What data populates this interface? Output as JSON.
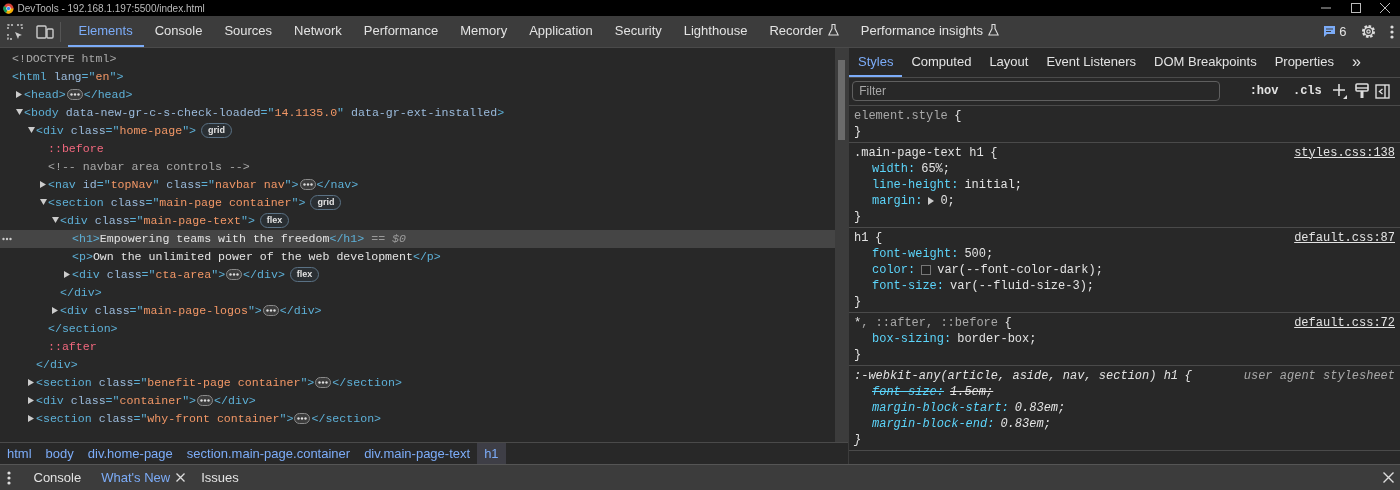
{
  "window": {
    "title": "DevTools - 192.168.1.197:5500/index.html"
  },
  "main_tabs": [
    {
      "label": "Elements",
      "selected": true,
      "experimental": false
    },
    {
      "label": "Console",
      "selected": false,
      "experimental": false
    },
    {
      "label": "Sources",
      "selected": false,
      "experimental": false
    },
    {
      "label": "Network",
      "selected": false,
      "experimental": false
    },
    {
      "label": "Performance",
      "selected": false,
      "experimental": false
    },
    {
      "label": "Memory",
      "selected": false,
      "experimental": false
    },
    {
      "label": "Application",
      "selected": false,
      "experimental": false
    },
    {
      "label": "Security",
      "selected": false,
      "experimental": false
    },
    {
      "label": "Lighthouse",
      "selected": false,
      "experimental": false
    },
    {
      "label": "Recorder",
      "selected": false,
      "experimental": true
    },
    {
      "label": "Performance insights",
      "selected": false,
      "experimental": true
    }
  ],
  "issues_count": "6",
  "dom_tree": [
    {
      "tokens": [
        {
          "kind": "doctype",
          "text": "<!DOCTYPE html>"
        }
      ]
    },
    {
      "tokens": [
        {
          "kind": "tag",
          "text": "<html "
        },
        {
          "kind": "attr",
          "text": "lang"
        },
        {
          "kind": "tag",
          "text": "=\""
        },
        {
          "kind": "value",
          "text": "en"
        },
        {
          "kind": "tag",
          "text": "\">"
        }
      ],
      "children": [
        {
          "tokens": [
            {
              "kind": "tag",
              "text": "<head>"
            }
          ],
          "expanded": false,
          "ellipsis": true,
          "close_tokens": [
            {
              "kind": "tag",
              "text": "</head>"
            }
          ]
        },
        {
          "tokens": [
            {
              "kind": "tag",
              "text": "<body "
            },
            {
              "kind": "attr",
              "text": "data-new-gr-c-s-check-loaded"
            },
            {
              "kind": "tag",
              "text": "=\""
            },
            {
              "kind": "value",
              "text": "14.1135.0"
            },
            {
              "kind": "tag",
              "text": "\" "
            },
            {
              "kind": "attr",
              "text": "data-gr-ext-installed"
            },
            {
              "kind": "tag",
              "text": ">"
            }
          ],
          "expanded": true,
          "children": [
            {
              "tokens": [
                {
                  "kind": "tag",
                  "text": "<div "
                },
                {
                  "kind": "attr",
                  "text": "class"
                },
                {
                  "kind": "tag",
                  "text": "=\""
                },
                {
                  "kind": "value",
                  "text": "home-page"
                },
                {
                  "kind": "tag",
                  "text": "\">"
                }
              ],
              "expanded": true,
              "badge": "grid",
              "children": [
                {
                  "tokens": [
                    {
                      "kind": "pseudo",
                      "text": "::before"
                    }
                  ]
                },
                {
                  "tokens": [
                    {
                      "kind": "comment",
                      "text": "<!-- navbar area controls  -->"
                    }
                  ]
                },
                {
                  "tokens": [
                    {
                      "kind": "tag",
                      "text": "<nav "
                    },
                    {
                      "kind": "attr",
                      "text": "id"
                    },
                    {
                      "kind": "tag",
                      "text": "=\""
                    },
                    {
                      "kind": "value",
                      "text": "topNav"
                    },
                    {
                      "kind": "tag",
                      "text": "\" "
                    },
                    {
                      "kind": "attr",
                      "text": "class"
                    },
                    {
                      "kind": "tag",
                      "text": "=\""
                    },
                    {
                      "kind": "value",
                      "text": "navbar nav"
                    },
                    {
                      "kind": "tag",
                      "text": "\">"
                    }
                  ],
                  "expanded": false,
                  "ellipsis": true,
                  "close_tokens": [
                    {
                      "kind": "tag",
                      "text": "</nav>"
                    }
                  ]
                },
                {
                  "tokens": [
                    {
                      "kind": "tag",
                      "text": "<section "
                    },
                    {
                      "kind": "attr",
                      "text": "class"
                    },
                    {
                      "kind": "tag",
                      "text": "=\""
                    },
                    {
                      "kind": "value",
                      "text": "main-page container"
                    },
                    {
                      "kind": "tag",
                      "text": "\">"
                    }
                  ],
                  "expanded": true,
                  "badge": "grid",
                  "children": [
                    {
                      "tokens": [
                        {
                          "kind": "tag",
                          "text": "<div "
                        },
                        {
                          "kind": "attr",
                          "text": "class"
                        },
                        {
                          "kind": "tag",
                          "text": "=\""
                        },
                        {
                          "kind": "value",
                          "text": "main-page-text"
                        },
                        {
                          "kind": "tag",
                          "text": "\">"
                        }
                      ],
                      "expanded": true,
                      "badge": "flex",
                      "children": [
                        {
                          "tokens": [
                            {
                              "kind": "tag",
                              "text": "<h1>"
                            },
                            {
                              "kind": "text",
                              "text": "Empowering teams with the freedom"
                            },
                            {
                              "kind": "tag",
                              "text": "</h1>"
                            },
                            {
                              "kind": "marker",
                              "text": " == $0"
                            }
                          ],
                          "selected": true
                        },
                        {
                          "tokens": [
                            {
                              "kind": "tag",
                              "text": "<p>"
                            },
                            {
                              "kind": "text",
                              "text": "Own the unlimited power of the web development"
                            },
                            {
                              "kind": "tag",
                              "text": "</p>"
                            }
                          ],
                          "selected": false
                        },
                        {
                          "tokens": [
                            {
                              "kind": "tag",
                              "text": "<div "
                            },
                            {
                              "kind": "attr",
                              "text": "class"
                            },
                            {
                              "kind": "tag",
                              "text": "=\""
                            },
                            {
                              "kind": "value",
                              "text": "cta-area"
                            },
                            {
                              "kind": "tag",
                              "text": "\">"
                            }
                          ],
                          "expanded": false,
                          "ellipsis": true,
                          "close_tokens": [
                            {
                              "kind": "tag",
                              "text": "</div>"
                            }
                          ],
                          "badge": "flex",
                          "selected": false
                        }
                      ],
                      "closing": [
                        {
                          "kind": "tag",
                          "text": "</div>"
                        }
                      ]
                    },
                    {
                      "tokens": [
                        {
                          "kind": "tag",
                          "text": "<div "
                        },
                        {
                          "kind": "attr",
                          "text": "class"
                        },
                        {
                          "kind": "tag",
                          "text": "=\""
                        },
                        {
                          "kind": "value",
                          "text": "main-page-logos"
                        },
                        {
                          "kind": "tag",
                          "text": "\">"
                        }
                      ],
                      "expanded": false,
                      "ellipsis": true,
                      "close_tokens": [
                        {
                          "kind": "tag",
                          "text": "</div>"
                        }
                      ]
                    }
                  ],
                  "closing": [
                    {
                      "kind": "tag",
                      "text": "</section>"
                    }
                  ]
                },
                {
                  "tokens": [
                    {
                      "kind": "pseudo",
                      "text": "::after"
                    }
                  ]
                }
              ],
              "closing": [
                {
                  "kind": "tag",
                  "text": "</div>"
                }
              ]
            },
            {
              "tokens": [
                {
                  "kind": "tag",
                  "text": "<section "
                },
                {
                  "kind": "attr",
                  "text": "class"
                },
                {
                  "kind": "tag",
                  "text": "=\""
                },
                {
                  "kind": "value",
                  "text": "benefit-page container"
                },
                {
                  "kind": "tag",
                  "text": "\">"
                }
              ],
              "expanded": false,
              "ellipsis": true,
              "close_tokens": [
                {
                  "kind": "tag",
                  "text": "</section>"
                }
              ]
            },
            {
              "tokens": [
                {
                  "kind": "tag",
                  "text": "<div "
                },
                {
                  "kind": "attr",
                  "text": "class"
                },
                {
                  "kind": "tag",
                  "text": "=\""
                },
                {
                  "kind": "value",
                  "text": "container"
                },
                {
                  "kind": "tag",
                  "text": "\">"
                }
              ],
              "expanded": false,
              "ellipsis": true,
              "close_tokens": [
                {
                  "kind": "tag",
                  "text": "</div>"
                }
              ]
            },
            {
              "tokens": [
                {
                  "kind": "tag",
                  "text": "<section "
                },
                {
                  "kind": "attr",
                  "text": "class"
                },
                {
                  "kind": "tag",
                  "text": "=\""
                },
                {
                  "kind": "value",
                  "text": "why-front container"
                },
                {
                  "kind": "tag",
                  "text": "\">"
                }
              ],
              "expanded": false,
              "ellipsis": true,
              "close_tokens": [
                {
                  "kind": "tag",
                  "text": "</section>"
                }
              ]
            }
          ]
        }
      ]
    }
  ],
  "breadcrumbs": [
    {
      "label": "html",
      "selected": false
    },
    {
      "label": "body",
      "selected": false
    },
    {
      "label": "div.home-page",
      "selected": false
    },
    {
      "label": "section.main-page.container",
      "selected": false
    },
    {
      "label": "div.main-page-text",
      "selected": false
    },
    {
      "label": "h1",
      "selected": true
    }
  ],
  "side_tabs": [
    {
      "label": "Styles",
      "selected": true
    },
    {
      "label": "Computed",
      "selected": false
    },
    {
      "label": "Layout",
      "selected": false
    },
    {
      "label": "Event Listeners",
      "selected": false
    },
    {
      "label": "DOM Breakpoints",
      "selected": false
    },
    {
      "label": "Properties",
      "selected": false
    }
  ],
  "more_tabs": "»",
  "filter": {
    "placeholder": "Filter"
  },
  "hov": ":hov",
  "cls": ".cls",
  "rules": [
    {
      "kind": "author",
      "selector": [
        {
          "text": "element.style",
          "matched": false
        }
      ],
      "open": "{",
      "close": "}"
    },
    {
      "kind": "author",
      "selector": [
        {
          "text": ".main-page-text h1",
          "matched": true
        }
      ],
      "open": "{",
      "close": "}",
      "source": "styles.css:138",
      "declarations": [
        {
          "name": "width:",
          "value": "65%;",
          "overridden": false
        },
        {
          "name": "line-height:",
          "value": "initial;",
          "overridden": false
        },
        {
          "name": "margin:",
          "value": "0;",
          "overridden": false,
          "expandable": true
        }
      ]
    },
    {
      "kind": "author",
      "selector": [
        {
          "text": "h1",
          "matched": true
        }
      ],
      "open": "{",
      "close": "}",
      "source": "default.css:87",
      "declarations": [
        {
          "name": "font-weight:",
          "value": "500;",
          "overridden": false
        },
        {
          "name": "color:",
          "value": "var(--font-color-dark);",
          "overridden": false,
          "color": "#222222"
        },
        {
          "name": "font-size:",
          "value": "var(--fluid-size-3);",
          "overridden": false
        }
      ]
    },
    {
      "kind": "author",
      "selector": [
        {
          "text": "*",
          "matched": true
        },
        {
          "text": ", ::after, ::before",
          "matched": false
        }
      ],
      "open": "{",
      "close": "}",
      "source": "default.css:72",
      "declarations": [
        {
          "name": "box-sizing:",
          "value": "border-box;",
          "overridden": false
        }
      ]
    },
    {
      "kind": "user_agent",
      "selector": [
        {
          "text": ":-webkit-any(article, aside, nav, section) h1",
          "matched": true
        }
      ],
      "open": "{",
      "close": "}",
      "source": "user agent stylesheet",
      "declarations": [
        {
          "name": "font-size:",
          "value": "1.5em;",
          "overridden": true
        },
        {
          "name": "margin-block-start:",
          "value": "0.83em;",
          "overridden": false
        },
        {
          "name": "margin-block-end:",
          "value": "0.83em;",
          "overridden": false
        }
      ]
    }
  ],
  "drawer_tabs": [
    {
      "label": "Console",
      "selected": false,
      "closable": false
    },
    {
      "label": "What's New",
      "selected": true,
      "closable": true
    },
    {
      "label": "Issues",
      "selected": false,
      "closable": false
    }
  ]
}
